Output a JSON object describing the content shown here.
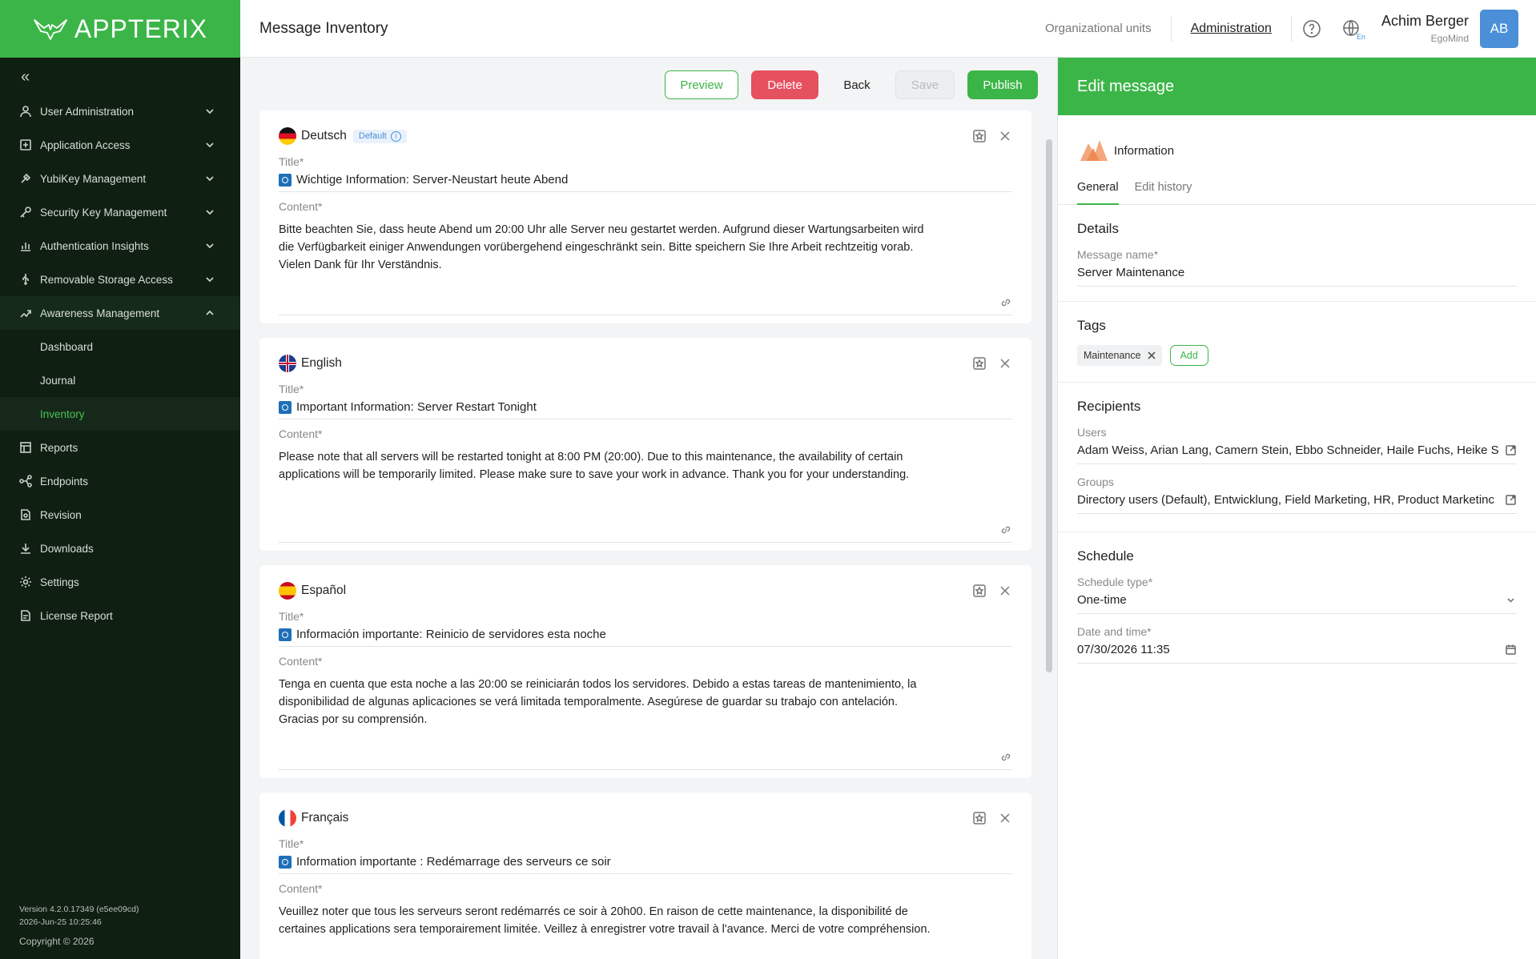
{
  "app": {
    "logo_text": "APPTERIX"
  },
  "header": {
    "title": "Message Inventory",
    "org_units": "Organizational units",
    "administration": "Administration",
    "lang_badge": "En",
    "user_name": "Achim Berger",
    "user_org": "EgoMind",
    "avatar_initials": "AB"
  },
  "sidebar": {
    "collapse_icon": "«",
    "items": [
      {
        "label": "User Administration",
        "icon": "user-icon"
      },
      {
        "label": "Application Access",
        "icon": "app-access-icon"
      },
      {
        "label": "YubiKey Management",
        "icon": "key-icon"
      },
      {
        "label": "Security Key Management",
        "icon": "security-key-icon"
      },
      {
        "label": "Authentication Insights",
        "icon": "chart-icon"
      },
      {
        "label": "Removable Storage Access",
        "icon": "usb-icon"
      },
      {
        "label": "Awareness Management",
        "icon": "awareness-icon"
      }
    ],
    "sub_items": [
      {
        "label": "Dashboard"
      },
      {
        "label": "Journal"
      },
      {
        "label": "Inventory"
      }
    ],
    "bottom_items": [
      {
        "label": "Reports"
      },
      {
        "label": "Endpoints"
      },
      {
        "label": "Revision"
      },
      {
        "label": "Downloads"
      },
      {
        "label": "Settings"
      },
      {
        "label": "License Report"
      }
    ],
    "footer": {
      "version": "Version 4.2.0.17349 (e5ee09cd)",
      "date": "2026-Jun-25 10:25:46",
      "copyright": "Copyright © 2026"
    }
  },
  "toolbar": {
    "preview": "Preview",
    "delete": "Delete",
    "back": "Back",
    "save": "Save",
    "publish": "Publish"
  },
  "languages": [
    {
      "name": "Deutsch",
      "default_badge": "Default",
      "title_label": "Title*",
      "title": "Wichtige Information: Server-Neustart heute Abend",
      "content_label": "Content*",
      "content_lines": [
        "Bitte beachten Sie, dass heute Abend um 20:00 Uhr alle Server neu gestartet werden. Aufgrund dieser Wartungsarbeiten wird",
        "die Verfügbarkeit einiger Anwendungen vorübergehend eingeschränkt sein. Bitte speichern Sie Ihre Arbeit rechtzeitig vorab.",
        "Vielen Dank für Ihr Verständnis."
      ]
    },
    {
      "name": "English",
      "title_label": "Title*",
      "title": "Important Information: Server Restart Tonight",
      "content_label": "Content*",
      "content_lines": [
        "Please note that all servers will be restarted tonight at 8:00 PM (20:00). Due to this maintenance, the availability of certain",
        "applications will be temporarily limited. Please make sure to save your work in advance. Thank you for your understanding.",
        ""
      ]
    },
    {
      "name": "Español",
      "title_label": "Title*",
      "title": "Información importante: Reinicio de servidores esta noche",
      "content_label": "Content*",
      "content_lines": [
        "Tenga en cuenta que esta noche a las 20:00 se reiniciarán todos los servidores. Debido a estas tareas de mantenimiento, la",
        "disponibilidad de algunas aplicaciones se verá limitada temporalmente. Asegúrese de guardar su trabajo con antelación.",
        "Gracias por su comprensión."
      ]
    },
    {
      "name": "Français",
      "title_label": "Title*",
      "title": "Information importante : Redémarrage des serveurs ce soir",
      "content_label": "Content*",
      "content_lines": [
        "Veuillez noter que tous les serveurs seront redémarrés ce soir à 20h00. En raison de cette maintenance, la disponibilité de",
        "certaines applications sera temporairement limitée. Veillez à enregistrer votre travail à l'avance. Merci de votre compréhension.",
        ""
      ]
    }
  ],
  "edit_panel": {
    "header": "Edit message",
    "type": "Information",
    "tabs": [
      "General",
      "Edit history"
    ],
    "details": {
      "heading": "Details",
      "name_label": "Message name*",
      "name_value": "Server Maintenance"
    },
    "tags": {
      "heading": "Tags",
      "items": [
        "Maintenance"
      ],
      "add": "Add"
    },
    "recipients": {
      "heading": "Recipients",
      "users_label": "Users",
      "users_value": "Adam Weiss, Arian Lang, Camern Stein, Ebbo Schneider, Haile Fuchs, Heike S",
      "groups_label": "Groups",
      "groups_value": "Directory users (Default), Entwicklung, Field Marketing, HR, Product Marketinc"
    },
    "schedule": {
      "heading": "Schedule",
      "type_label": "Schedule type*",
      "type_value": "One-time",
      "date_label": "Date and time*",
      "date_value": "07/30/2026 11:35"
    }
  }
}
